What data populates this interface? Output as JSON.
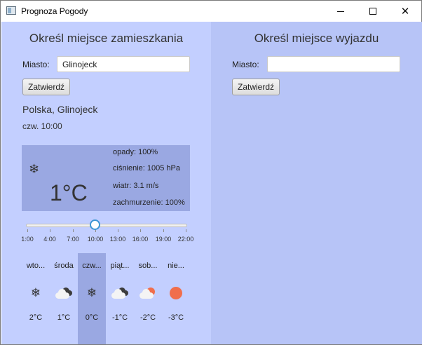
{
  "window": {
    "title": "Prognoza Pogody"
  },
  "home": {
    "heading": "Określ miejsce zamieszkania",
    "city_label": "Miasto:",
    "city_value": "Glinojeck",
    "submit_label": "Zatwierdź",
    "location": "Polska, Glinojeck",
    "datetime": "czw. 10:00",
    "current": {
      "icon": "snowflake-icon",
      "temperature": "1°C",
      "precipitation": "opady: 100%",
      "pressure": "ciśnienie: 1005 hPa",
      "wind": "wiatr: 3.1 m/s",
      "clouds": "zachmurzenie: 100%"
    },
    "time_slider": {
      "selected_index": 3,
      "labels": [
        "1:00",
        "4:00",
        "7:00",
        "10:00",
        "13:00",
        "16:00",
        "19:00",
        "22:00"
      ]
    },
    "forecast": [
      {
        "day": "wto...",
        "icon": "snowflake-icon",
        "temp": "2°C"
      },
      {
        "day": "środa",
        "icon": "dark-cloud-icon",
        "temp": "1°C"
      },
      {
        "day": "czw...",
        "icon": "snowflake-icon",
        "temp": "0°C",
        "selected": true
      },
      {
        "day": "piąt...",
        "icon": "dark-cloud-icon",
        "temp": "-1°C"
      },
      {
        "day": "sob...",
        "icon": "sun-behind-cloud-icon",
        "temp": "-2°C"
      },
      {
        "day": "nie...",
        "icon": "sun-icon",
        "temp": "-3°C"
      }
    ]
  },
  "trip": {
    "heading": "Określ miejsce wyjazdu",
    "city_label": "Miasto:",
    "city_value": "",
    "submit_label": "Zatwierdź"
  },
  "colors": {
    "left_panel": "#c3cfff",
    "right_panel": "#b7c4f7",
    "highlight": "#9aa8e2",
    "sun": "#f06e4c",
    "slider_accent": "#3c96d4"
  }
}
